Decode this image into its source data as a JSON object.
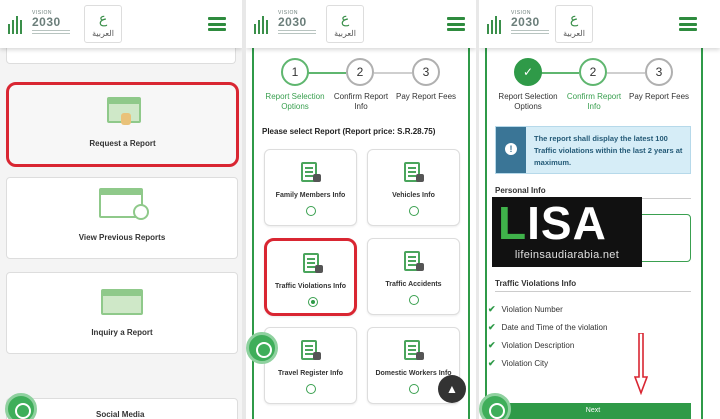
{
  "header": {
    "vision_label": "VISION",
    "vision_year": "2030",
    "arabic_label": "العربية"
  },
  "panel1": {
    "cards": [
      {
        "title": "Request a Report"
      },
      {
        "title": "View Previous Reports"
      },
      {
        "title": "Inquiry a Report"
      }
    ],
    "social_media": "Social Media"
  },
  "steps": [
    {
      "number": "1",
      "label": "Report Selection Options"
    },
    {
      "number": "2",
      "label": "Confirm Report Info"
    },
    {
      "number": "3",
      "label": "Pay Report Fees"
    }
  ],
  "panel2": {
    "heading": "Please select Report (Report price: S.R.28.75)",
    "reports": [
      {
        "title": "Family Members Info",
        "selected": false
      },
      {
        "title": "Vehicles Info",
        "selected": false
      },
      {
        "title": "Traffic Violations Info",
        "selected": true
      },
      {
        "title": "Traffic Accidents",
        "selected": false
      },
      {
        "title": "Travel Register Info",
        "selected": false
      },
      {
        "title": "Domestic Workers Info",
        "selected": false
      }
    ]
  },
  "panel3": {
    "notice": "The report shall display the latest 100 Traffic violations within the last 2 years at maximum.",
    "personal_info_title": "Personal Info",
    "violations_title": "Traffic Violations Info",
    "violation_fields": [
      "Violation Number",
      "Date and Time of the violation",
      "Violation Description",
      "Violation City"
    ],
    "next_label": "Next"
  },
  "watermark": {
    "big": "LISA",
    "site": "lifeinsaudiarabia.net"
  },
  "colors": {
    "brand_green": "#2f9a48",
    "highlight_red": "#d92632",
    "notice_blue": "#d6edf7"
  }
}
